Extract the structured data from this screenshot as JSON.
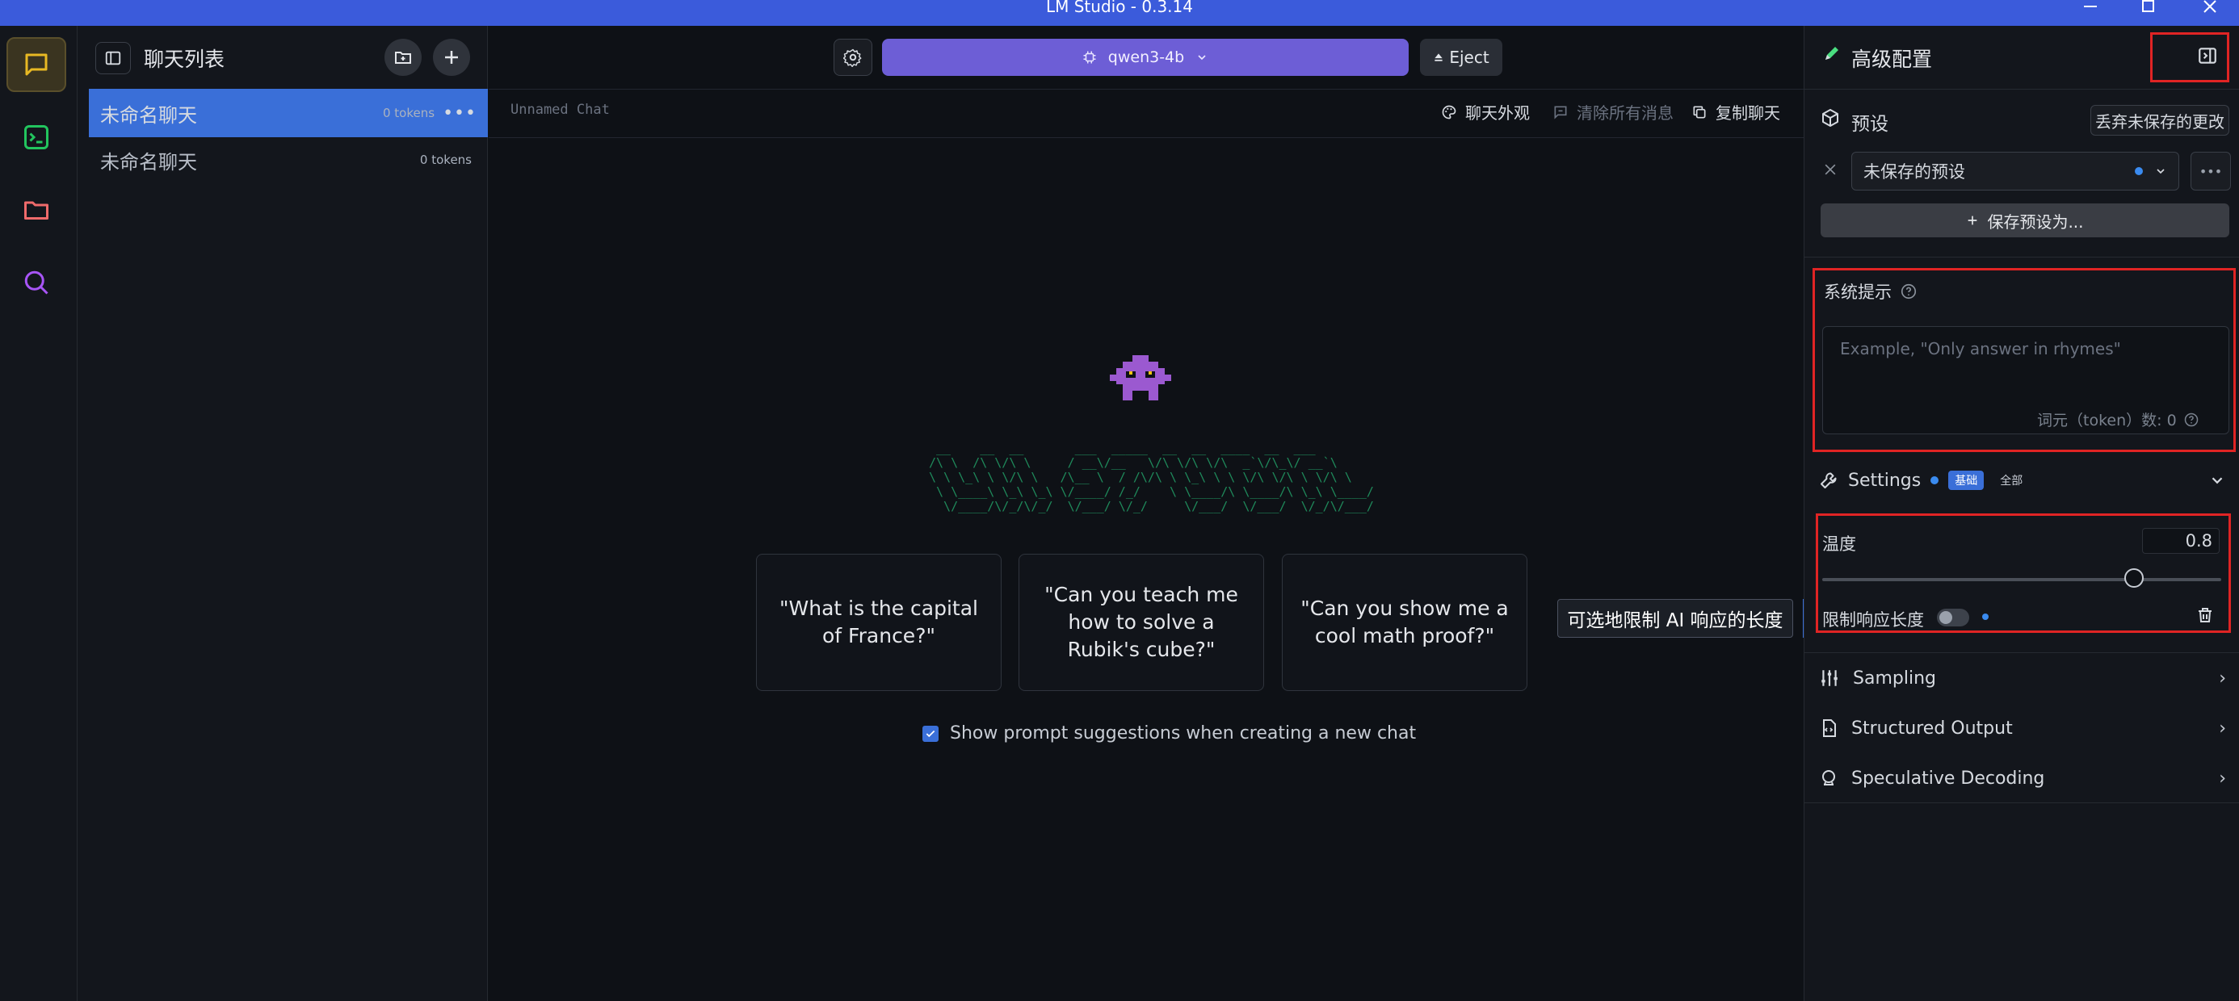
{
  "window": {
    "title": "LM Studio - 0.3.14"
  },
  "rail": {
    "items": [
      "chat",
      "developer",
      "my-models",
      "discover"
    ]
  },
  "chatlist": {
    "title": "聊天列表",
    "chats": [
      {
        "name": "未命名聊天",
        "tokens": "0 tokens",
        "selected": true
      },
      {
        "name": "未命名聊天",
        "tokens": "0 tokens",
        "selected": false
      }
    ]
  },
  "toolbar": {
    "model_label": "qwen3-4b",
    "eject_label": "Eject"
  },
  "chat": {
    "name": "Unnamed Chat",
    "actions": {
      "appearance": "聊天外观",
      "clear": "清除所有消息",
      "copy": "复制聊天"
    },
    "ascii_logo": " __    __  __       ___  _____  __  __  ____  __  ___  \n/\\ \\  /\\ \\/\\ \\     / __\\/__   \\/\\ \\/\\ \\/\\  _`\\/\\_\\/ __`\\\n\\ \\ \\_\\ \\ \\/\\ \\   /\\__ \\  / /\\/\\ \\ \\_\\ \\ \\ \\/\\ \\/\\ \\ \\/\\ \\\n \\ \\____\\ \\_\\ \\_\\ \\/____/ /_/    \\ \\____/\\ \\____/\\ \\_\\ \\____/\n  \\/____/\\/_/\\/_/  \\/___/ \\/_/     \\/___/  \\/___/  \\/_/\\/___/",
    "suggestions": [
      "\"What is the capital of France?\"",
      "\"Can you teach me how to solve a Rubik's cube?\"",
      "\"Can you show me a cool math proof?\""
    ],
    "show_suggestions_label": "Show prompt suggestions when creating a new chat",
    "tooltip": "可选地限制 AI 响应的长度"
  },
  "right": {
    "title": "高级配置",
    "preset": {
      "label": "预设",
      "discard": "丢弃未保存的更改",
      "selected": "未保存的预设",
      "save_as": "保存预设为..."
    },
    "system_prompt": {
      "label": "系统提示",
      "placeholder": "Example, \"Only answer in rhymes\"",
      "token_count": "词元（token）数: 0"
    },
    "settings": {
      "label": "Settings",
      "tab_basic": "基础",
      "tab_all": "全部",
      "temperature_label": "温度",
      "temperature_value": "0.8",
      "limit_label": "限制响应长度"
    },
    "sections": [
      "Sampling",
      "Structured Output",
      "Speculative Decoding"
    ]
  },
  "colors": {
    "accent": "#3a6fd8",
    "model_button": "#6d5ed6",
    "highlight_box": "#e02424",
    "ascii_green": "#1f8a5b"
  }
}
